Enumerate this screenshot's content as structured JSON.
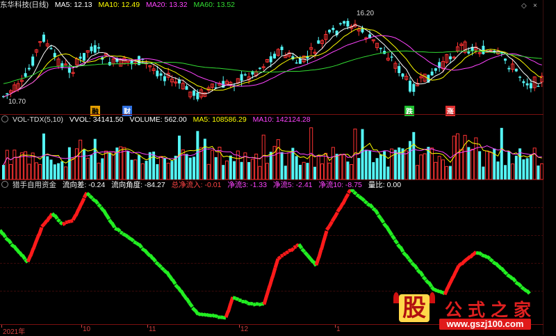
{
  "main_header": {
    "title": "东华科技(日线)",
    "ma5": "MA5: 12.13",
    "ma10": "MA10: 12.49",
    "ma20": "MA20: 13.32",
    "ma60": "MA60: 13.52"
  },
  "price_labels": {
    "high": "16.20",
    "low": "10.70"
  },
  "event_tags": [
    "融",
    "财",
    "跌",
    "涨"
  ],
  "vol_header": {
    "name": "VOL-TDX(5,10)",
    "vvol": "VVOL: 34141.50",
    "volume": "VOLUME: 562.00",
    "ma5": "MA5: 108586.29",
    "ma10": "MA10: 142124.28"
  },
  "ind_header": {
    "name": "猎手自用资金",
    "items": [
      "流向差: -0.24",
      "流向角度: -84.27",
      "总净流入: -0.01",
      "净流3: -1.33",
      "净流5: -2.41",
      "净流10: -8.75",
      "量比: 0.00"
    ]
  },
  "axis_labels": [
    "2021年",
    "10",
    "11",
    "12",
    "1"
  ],
  "logo": {
    "mark": "股",
    "title": "公式之家",
    "url": "www.gszj100.com"
  },
  "window_controls": [
    "◇",
    "×"
  ],
  "colors": {
    "up": "#ff3333",
    "down": "#54f5f5",
    "ma5": "#ffffff",
    "ma10": "#ffff00",
    "ma20": "#ff44ff",
    "ma60": "#33dd33",
    "flow_up": "#ff1a1a",
    "flow_down": "#22ee22"
  }
}
